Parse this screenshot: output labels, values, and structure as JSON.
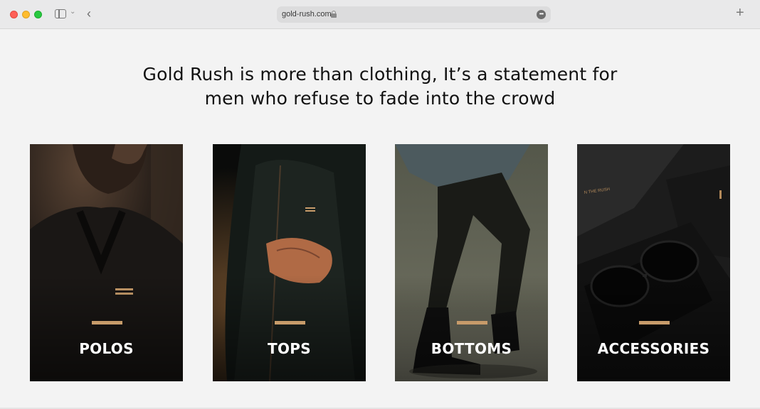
{
  "browser": {
    "url": "gold-rush.com",
    "more_glyph": "•••",
    "back_glyph": "‹",
    "new_tab_glyph": "+",
    "chevron_glyph": "⌄"
  },
  "hero": {
    "line1": "Gold Rush is more than clothing, It’s a statement for",
    "line2": "men who refuse to fade into the crowd"
  },
  "categories": [
    {
      "label": "POLOS",
      "image": "man-in-dark-polo-photo"
    },
    {
      "label": "TOPS",
      "image": "man-in-bomber-jacket-photo"
    },
    {
      "label": "BOTTOMS",
      "image": "man-in-cargo-pants-and-boots-photo"
    },
    {
      "label": "ACCESSORIES",
      "image": "sunglasses-in-gift-box-photo"
    }
  ],
  "colors": {
    "accent_bar": "#c79b6a",
    "page_background": "#f3f3f3",
    "card_label": "#ffffff"
  }
}
